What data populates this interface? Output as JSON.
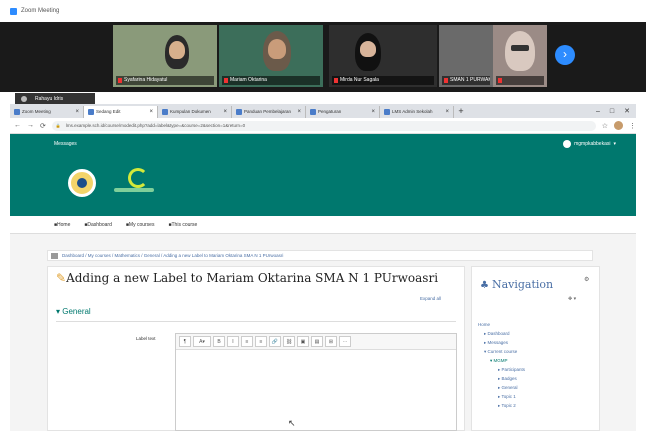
{
  "zoom": {
    "window_title": "Zoom Meeting",
    "self_view_name": "Rahayu Idris"
  },
  "participants": [
    {
      "name": "Syafarina Hidayatul"
    },
    {
      "name": "Mariam Oktarina"
    },
    {
      "name": "Mirda Nur Sagala"
    },
    {
      "name": "SMAN 1 PURWAKARTA"
    },
    {
      "name": ""
    }
  ],
  "browser": {
    "tabs": [
      "Zoom Meeting",
      "Sedang Edit",
      "Kumpulan Dokumen",
      "Panduan Pembelajaran",
      "Pengaturan",
      "LMS Admin Sekolah"
    ],
    "url": "lms.example.sch.id/course/modedit.php?add=label&type=&course=2&section=1&return=0",
    "back": "←",
    "forward": "→",
    "reload": "⟳",
    "minimize": "–",
    "maximize": "□",
    "close": "✕"
  },
  "lms": {
    "navbar_label": "Messages",
    "user_name": "mgmpkabbekasi",
    "subnav": [
      "Home",
      "Dashboard",
      "My courses",
      "This course"
    ],
    "breadcrumb": "Dashboard / My courses / Mathematics / General / Adding a new Label to Mariam Oktarina SMA N 1 PUrwoasri",
    "page_title": "Adding a new Label to Mariam Oktarina SMA N 1 PUrwoasri",
    "help_link": "Expand all",
    "section_title": "General",
    "field_label": "Label text",
    "editor_buttons": [
      "¶",
      "A▾",
      "B",
      "I",
      "≡",
      "≡",
      "🔗",
      "⛓",
      "▣",
      "▤",
      "⊞",
      "⋯"
    ],
    "navigation": {
      "title": "Navigation",
      "items": [
        "Home",
        "Dashboard",
        "Messages",
        "Current course",
        "MGMP",
        "Participants",
        "Badges",
        "General",
        "Topic 1",
        "Topic 2"
      ]
    }
  },
  "colors": {
    "moodle_green": "#00786e",
    "zoom_blue": "#2d8cff",
    "link_blue": "#4a6fa5"
  }
}
